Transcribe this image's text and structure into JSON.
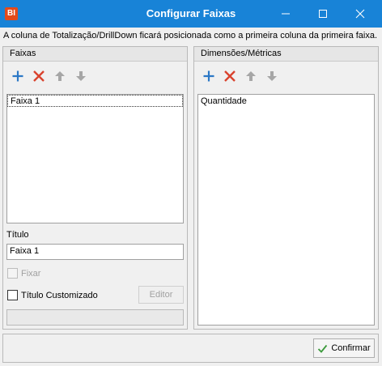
{
  "window": {
    "app_icon_text": "BI",
    "title": "Configurar Faixas",
    "minimize_icon": "minimize-icon",
    "maximize_icon": "maximize-icon",
    "close_icon": "close-icon"
  },
  "info": {
    "text": "A coluna de Totalização/DrillDown ficará posicionada como a primeira coluna da primeira faixa."
  },
  "faixas_panel": {
    "header": "Faixas",
    "toolbar": [
      "add-icon",
      "remove-icon",
      "move-up-icon",
      "move-down-icon"
    ],
    "items": [
      "Faixa 1"
    ],
    "selected_index": 0,
    "titulo_label": "Título",
    "titulo_value": "Faixa 1",
    "fixar_label": "Fixar",
    "fixar_checked": false,
    "fixar_enabled": false,
    "titulo_customizado_label": "Título Customizado",
    "titulo_customizado_checked": false,
    "editor_label": "Editor",
    "editor_enabled": false
  },
  "dimensoes_panel": {
    "header": "Dimensões/Métricas",
    "toolbar": [
      "add-icon",
      "remove-icon",
      "move-up-icon",
      "move-down-icon"
    ],
    "items": [
      "Quantidade"
    ]
  },
  "footer": {
    "confirm_label": "Confirmar",
    "confirm_icon": "check-icon"
  },
  "colors": {
    "titlebar": "#1883d7",
    "add_icon": "#2b78c6",
    "remove_icon": "#d9432e",
    "arrow_icon": "#a6a6a6",
    "check_icon": "#3c9a3c"
  }
}
